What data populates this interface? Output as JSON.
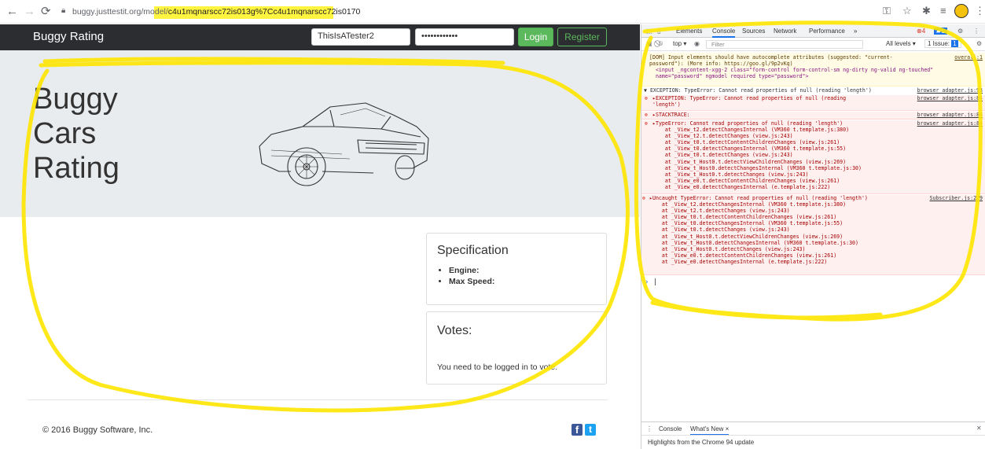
{
  "browser": {
    "url_host": "buggy.justtestit.org/model/",
    "url_path": "c4u1mqnarscc72is013g%7Cc4u1mqnarscc72is0170",
    "back_icon": "arrow-left-icon",
    "forward_icon": "arrow-right-icon",
    "reload_icon": "reload-icon"
  },
  "site": {
    "brand": "Buggy Rating",
    "login_value": "ThisIsATester2",
    "password_value": "••••••••••••",
    "login_label": "Login",
    "register_label": "Register",
    "jumbotron_title": [
      "Buggy",
      "Cars",
      "Rating"
    ],
    "spec_title": "Specification",
    "spec_items": [
      "Engine:",
      "Max Speed:"
    ],
    "votes_title": "Votes:",
    "votes_message": "You need to be logged in to vote.",
    "copyright": "© 2016 Buggy Software, Inc.",
    "facebook_glyph": "f",
    "twitter_glyph": "t"
  },
  "devtools": {
    "tabs": [
      "Elements",
      "Console",
      "Sources",
      "Network",
      "Performance",
      "»"
    ],
    "active_tab": "Console",
    "error_count": "4",
    "message_count": "1",
    "context": "top ▾",
    "filter_placeholder": "Filter",
    "levels": "All levels ▾",
    "issues": "1 Issue:",
    "issue_count": "1",
    "warning": {
      "lines": [
        "[DOM] Input elements should have autocomplete attributes (suggested: \"current-",
        "password\"): (More info: https://goo.gl/9p2vKq)",
        "  <input _ngcontent-xgg-2 class=\"form-control form-control-sm ng-dirty ng-valid ng-touched\"",
        "  name=\"password\" ngmodel required type=\"password\">"
      ],
      "source": "overall:1"
    },
    "exception_header": "▼ EXCEPTION: TypeError: Cannot read properties of null (reading 'length')",
    "exception_header_source": "browser adapter.js:93",
    "exception_lines": [
      {
        "text": "▸EXCEPTION: TypeError: Cannot read properties of null (reading",
        "cont": "'length')",
        "source": "browser adapter.js:84"
      },
      {
        "text": "▸STACKTRACE:",
        "cont": "",
        "source": "browser adapter.js:84"
      },
      {
        "text": "▸TypeError: Cannot read properties of null (reading 'length')",
        "cont": "",
        "source": "browser adapter.js:84"
      }
    ],
    "stack1": [
      "    at _View_t2.detectChangesInternal (VM360 t.template.js:380)",
      "    at _View_t2.t.detectChanges (view.js:243)",
      "    at _View_t0.t.detectContentChildrenChanges (view.js:261)",
      "    at _View_t0.detectChangesInternal (VM360 t.template.js:55)",
      "    at _View_t0.t.detectChanges (view.js:243)",
      "    at _View_t_Host0.t.detectViewChildrenChanges (view.js:269)",
      "    at _View_t_Host0.detectChangesInternal (VM360 t.template.js:30)",
      "    at _View_t_Host0.t.detectChanges (view.js:243)",
      "    at _View_e0.t.detectContentChildrenChanges (view.js:261)",
      "    at _View_e0.detectChangesInternal (e.template.js:222)"
    ],
    "uncaught": "▸Uncaught TypeError: Cannot read properties of null (reading 'length')",
    "uncaught_source": "Subscriber.js:229",
    "stack2": [
      "    at _View_t2.detectChangesInternal (VM360 t.template.js:380)",
      "    at _View_t2.t.detectChanges (view.js:243)",
      "    at _View_t0.t.detectContentChildrenChanges (view.js:261)",
      "    at _View_t0.detectChangesInternal (VM360 t.template.js:55)",
      "    at _View_t0.t.detectChanges (view.js:243)",
      "    at _View_t_Host0.t.detectViewChildrenChanges (view.js:269)",
      "    at _View_t_Host0.detectChangesInternal (VM360 t.template.js:30)",
      "    at _View_t_Host0.t.detectChanges (view.js:243)",
      "    at _View_e0.t.detectContentChildrenChanges (view.js:261)",
      "    at _View_e0.detectChangesInternal (e.template.js:222)"
    ],
    "prompt": "›",
    "drawer_tabs": [
      "Console",
      "What's New ×"
    ],
    "drawer_message": "Highlights from the Chrome 94 update"
  },
  "colors": {
    "highlight": "#fff200",
    "error": "#a50000",
    "login_green": "#5cb85c"
  }
}
